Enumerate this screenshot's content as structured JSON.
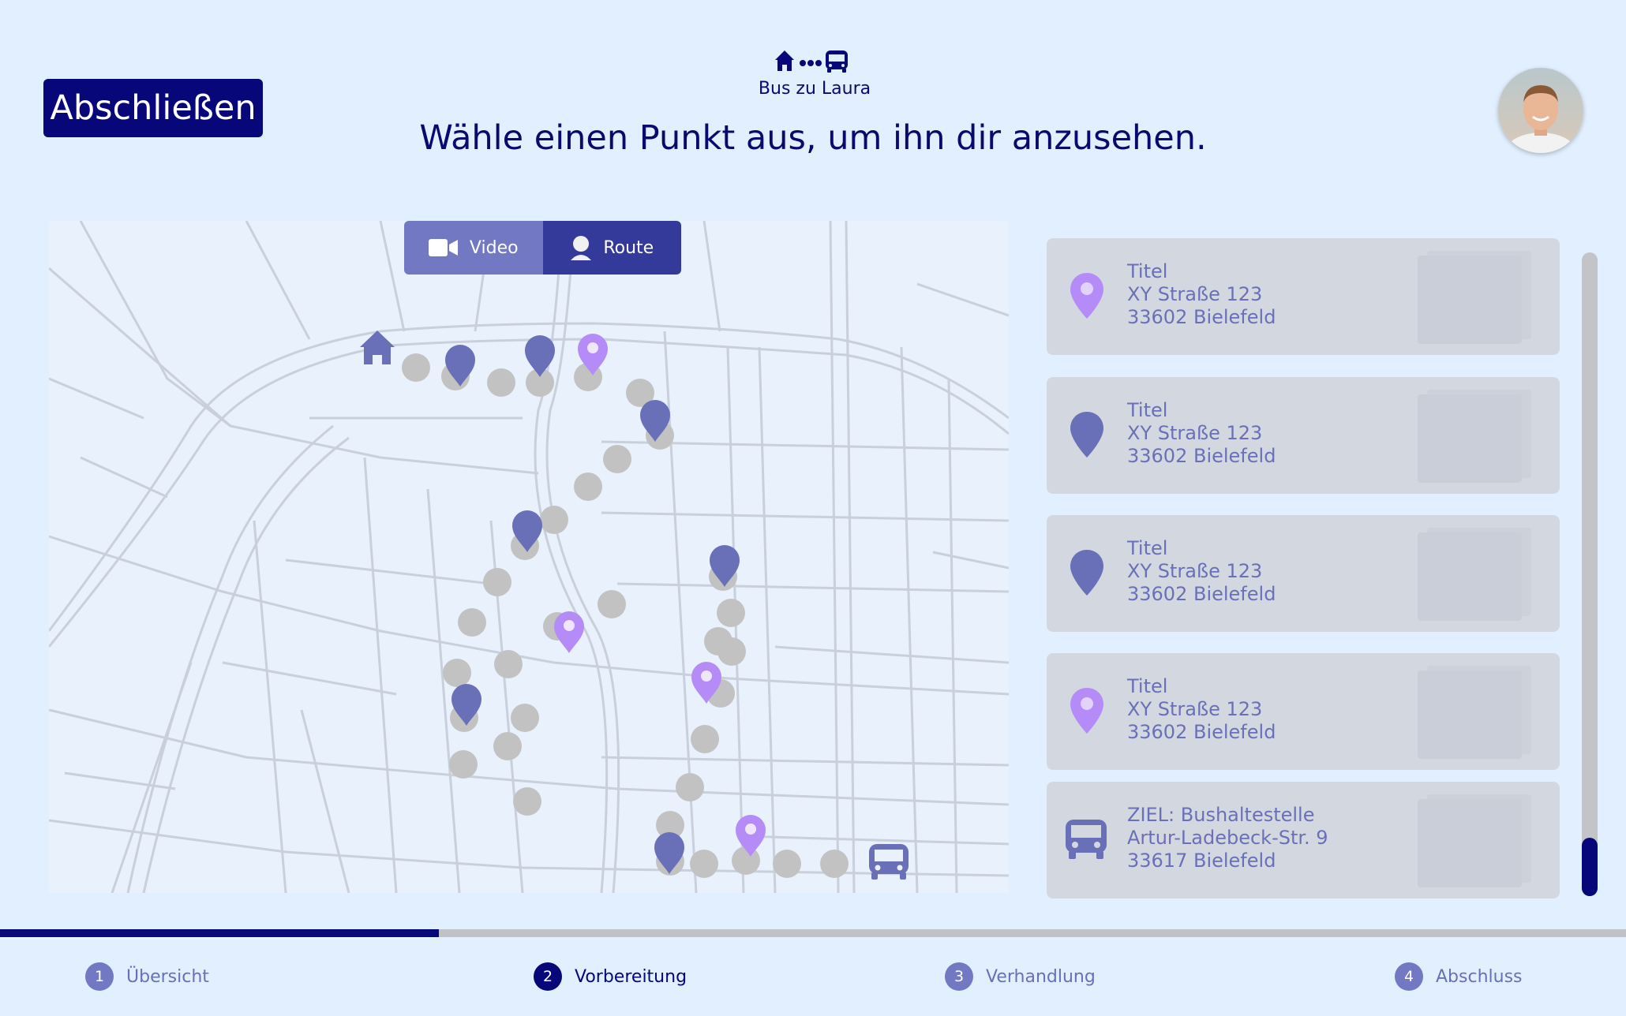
{
  "finish_button": {
    "label": "Abschließen"
  },
  "header": {
    "icons": [
      "home-icon",
      "dots-icon",
      "bus-icon"
    ],
    "subtitle": "Bus zu Laura",
    "headline": "Wähle einen Punkt aus, um ihn dir anzusehen."
  },
  "view_toggle": {
    "options": [
      {
        "label": "Video",
        "icon": "video-camera-icon",
        "selected": false
      },
      {
        "label": "Route",
        "icon": "person-icon",
        "selected": true
      }
    ]
  },
  "points": [
    {
      "title": "Titel",
      "street": "XY Straße 123",
      "city": "33602 Bielefeld",
      "icon": "map-pin-light-icon"
    },
    {
      "title": "Titel",
      "street": "XY Straße 123",
      "city": "33602 Bielefeld",
      "icon": "map-pin-dark-icon"
    },
    {
      "title": "Titel",
      "street": "XY Straße 123",
      "city": "33602 Bielefeld",
      "icon": "map-pin-dark-icon"
    },
    {
      "title": "Titel",
      "street": "XY Straße 123",
      "city": "33602 Bielefeld",
      "icon": "map-pin-light-icon"
    },
    {
      "title": "ZIEL: Bushaltestelle",
      "street": "Artur-Ladebeck-Str. 9",
      "city": "33617 Bielefeld",
      "icon": "bus-icon"
    }
  ],
  "progress": {
    "fraction": 0.27
  },
  "steps": [
    {
      "number": "1",
      "label": "Übersicht",
      "active": false
    },
    {
      "number": "2",
      "label": "Vorbereitung",
      "active": true
    },
    {
      "number": "3",
      "label": "Verhandlung",
      "active": false
    },
    {
      "number": "4",
      "label": "Abschluss",
      "active": false
    }
  ],
  "colors": {
    "background": "#e2efff",
    "primary": "#07077a",
    "pin_dark": "#6a70b8",
    "pin_light": "#b58cf7",
    "route_dot": "#c2c2c2",
    "card": "#d3d8e0"
  }
}
